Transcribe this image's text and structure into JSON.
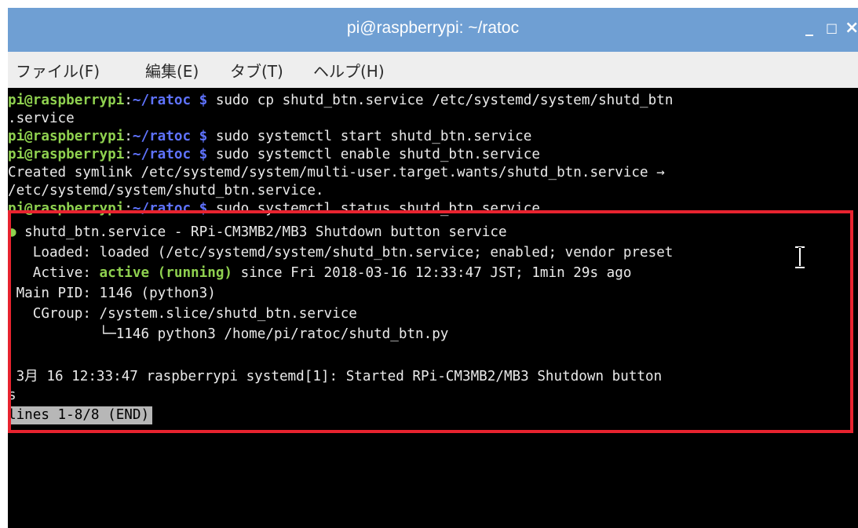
{
  "window": {
    "title": "pi@raspberrypi: ~/ratoc",
    "minimize_glyph": "_",
    "maximize_glyph": "□",
    "close_glyph": "×"
  },
  "menu": [
    {
      "label": "ファイル(F)"
    },
    {
      "label": "編集(E)"
    },
    {
      "label": "タブ(T)"
    },
    {
      "label": "ヘルプ(H)"
    }
  ],
  "terminal": {
    "user_host": "pi@raspberrypi",
    "colon": ":",
    "path": "~/ratoc",
    "prompt_symbol": "$",
    "lines": [
      {
        "cmd": " sudo cp shutd_btn.service /etc/systemd/system/shutd_btn"
      },
      {
        "text": ".service"
      },
      {
        "cmd": " sudo systemctl start shutd_btn.service"
      },
      {
        "cmd": " sudo systemctl enable shutd_btn.service"
      },
      {
        "text": "Created symlink /etc/systemd/system/multi-user.target.wants/shutd_btn.service →"
      },
      {
        "text": "/etc/systemd/system/shutd_btn.service."
      },
      {
        "cmd": " sudo systemctl status shutd_btn.service"
      },
      {
        "bullet": "●",
        "text": " shutd_btn.service - RPi-CM3MB2/MB3 Shutdown button service"
      },
      {
        "text": "   Loaded: loaded (/etc/systemd/system/shutd_btn.service; enabled; vendor preset"
      },
      {
        "pre": "   Active: ",
        "active": "active (running)",
        "post": " since Fri 2018-03-16 12:33:47 JST; 1min 29s ago"
      },
      {
        "text": " Main PID: 1146 (python3)"
      },
      {
        "text": "   CGroup: /system.slice/shutd_btn.service"
      },
      {
        "text": "           └─1146 python3 /home/pi/ratoc/shutd_btn.py"
      },
      {
        "text": ""
      },
      {
        "text": " 3月 16 12:33:47 raspberrypi systemd[1]: Started RPi-CM3MB2/MB3 Shutdown button"
      },
      {
        "text": "s"
      }
    ],
    "pager_status": "lines 1-8/8 (END)"
  },
  "colors": {
    "titlebar": "#6f9fd3",
    "menubar": "#eeeeee",
    "terminal_bg": "#000000",
    "user_green": "#8fd14f",
    "path_blue": "#5f73ff",
    "highlight_red": "#e8232f"
  }
}
